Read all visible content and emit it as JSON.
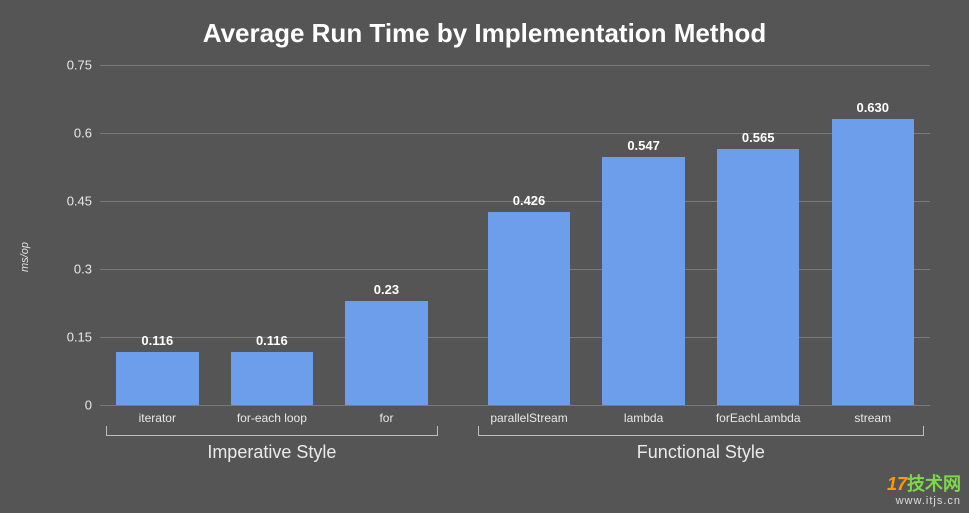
{
  "chart_data": {
    "type": "bar",
    "title": "Average Run Time by Implementation Method",
    "ylabel": "ms/op",
    "ylim": [
      0,
      0.75
    ],
    "yticks": [
      0,
      0.15,
      0.3,
      0.45,
      0.6,
      0.75
    ],
    "groups": [
      {
        "label": "Imperative Style",
        "span": 3
      },
      {
        "label": "Functional Style",
        "span": 4
      }
    ],
    "categories": [
      "iterator",
      "for-each loop",
      "for",
      "parallelStream",
      "lambda",
      "forEachLambda",
      "stream"
    ],
    "values": [
      0.116,
      0.116,
      0.23,
      0.426,
      0.547,
      0.565,
      0.63
    ],
    "value_labels": [
      "0.116",
      "0.116",
      "0.23",
      "0.426",
      "0.547",
      "0.565",
      "0.630"
    ]
  },
  "watermark": {
    "brand_prefix": "17",
    "brand_suffix": "技术网",
    "url": "www.itjs.cn"
  }
}
